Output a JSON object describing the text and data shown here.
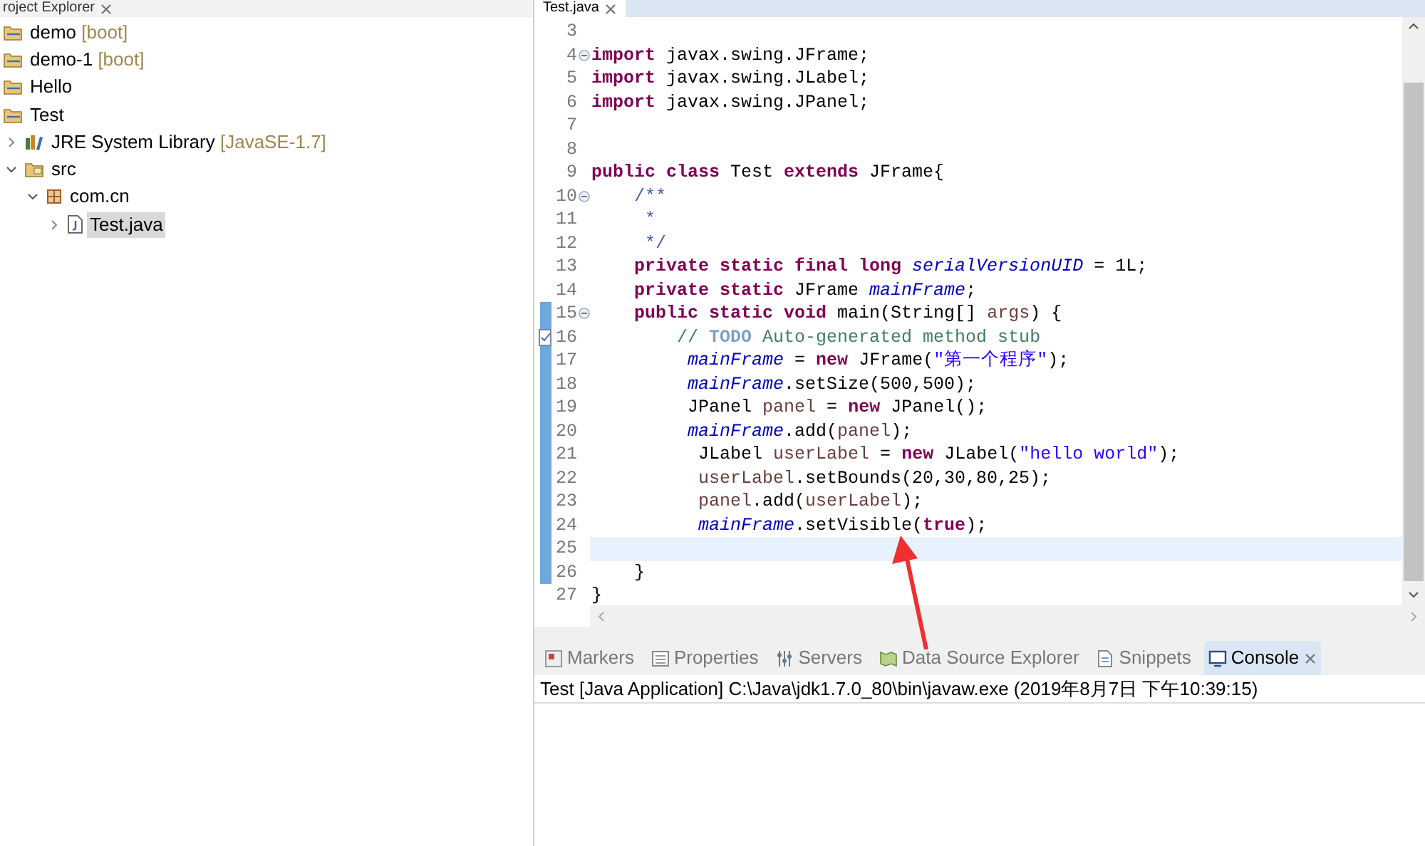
{
  "explorer": {
    "title": "roject Explorer",
    "tree": [
      {
        "kind": "project",
        "label": "demo",
        "decoration": "[boot]",
        "selected": false
      },
      {
        "kind": "project",
        "label": "demo-1",
        "decoration": "[boot]",
        "selected": false
      },
      {
        "kind": "project",
        "label": "Hello",
        "selected": false
      },
      {
        "kind": "project",
        "label": "Test",
        "selected": false,
        "children": [
          {
            "kind": "library",
            "label": "JRE System Library",
            "decoration": "[JavaSE-1.7]",
            "expanded": false,
            "selected": false
          },
          {
            "kind": "source-folder",
            "label": "src",
            "expanded": true,
            "selected": false,
            "children": [
              {
                "kind": "package",
                "label": "com.cn",
                "expanded": true,
                "selected": false,
                "children": [
                  {
                    "kind": "java-file",
                    "label": "Test.java",
                    "expanded": false,
                    "selected": true
                  }
                ]
              }
            ]
          }
        ]
      }
    ]
  },
  "editor": {
    "tab": "Test.java",
    "lines": [
      {
        "number": "3",
        "fold": false,
        "changed": false,
        "task": false,
        "current": false
      },
      {
        "number": "4",
        "fold": true,
        "changed": false,
        "task": false,
        "current": false,
        "tokens": [
          {
            "kind": "keyword",
            "text": "import"
          },
          {
            "kind": "plain",
            "text": " javax.swing.JFrame;"
          }
        ]
      },
      {
        "number": "5",
        "fold": false,
        "changed": false,
        "task": false,
        "current": false,
        "tokens": [
          {
            "kind": "keyword",
            "text": "import"
          },
          {
            "kind": "plain",
            "text": " javax.swing.JLabel;"
          }
        ]
      },
      {
        "number": "6",
        "fold": false,
        "changed": false,
        "task": false,
        "current": false,
        "tokens": [
          {
            "kind": "keyword",
            "text": "import"
          },
          {
            "kind": "plain",
            "text": " javax.swing.JPanel;"
          }
        ]
      },
      {
        "number": "7",
        "fold": false,
        "changed": false,
        "task": false,
        "current": false
      },
      {
        "number": "8",
        "fold": false,
        "changed": false,
        "task": false,
        "current": false
      },
      {
        "number": "9",
        "fold": false,
        "changed": false,
        "task": false,
        "current": false,
        "tokens": [
          {
            "kind": "keyword",
            "text": "public class"
          },
          {
            "kind": "plain",
            "text": " Test "
          },
          {
            "kind": "keyword",
            "text": "extends"
          },
          {
            "kind": "plain",
            "text": " JFrame{"
          }
        ]
      },
      {
        "number": "10",
        "fold": true,
        "changed": false,
        "task": false,
        "current": false,
        "tokens": [
          {
            "kind": "javadoc",
            "text": "    /**"
          }
        ]
      },
      {
        "number": "11",
        "fold": false,
        "changed": false,
        "task": false,
        "current": false,
        "tokens": [
          {
            "kind": "javadoc",
            "text": "     *"
          }
        ]
      },
      {
        "number": "12",
        "fold": false,
        "changed": false,
        "task": false,
        "current": false,
        "tokens": [
          {
            "kind": "javadoc",
            "text": "     */"
          }
        ]
      },
      {
        "number": "13",
        "fold": false,
        "changed": false,
        "task": false,
        "current": false,
        "tokens": [
          {
            "kind": "keyword",
            "text": "    private static final long"
          },
          {
            "kind": "field",
            "text": " serialVersionUID"
          },
          {
            "kind": "plain",
            "text": " = 1L;"
          }
        ]
      },
      {
        "number": "14",
        "fold": false,
        "changed": false,
        "task": false,
        "current": false,
        "tokens": [
          {
            "kind": "keyword",
            "text": "    private static"
          },
          {
            "kind": "plain",
            "text": " JFrame "
          },
          {
            "kind": "field",
            "text": "mainFrame"
          },
          {
            "kind": "plain",
            "text": ";"
          }
        ]
      },
      {
        "number": "15",
        "fold": true,
        "changed": true,
        "task": false,
        "current": false,
        "tokens": [
          {
            "kind": "keyword",
            "text": "    public static void"
          },
          {
            "kind": "plain",
            "text": " main(String[] "
          },
          {
            "kind": "local",
            "text": "args"
          },
          {
            "kind": "plain",
            "text": ") {"
          }
        ]
      },
      {
        "number": "16",
        "fold": false,
        "changed": true,
        "task": true,
        "current": false,
        "tokens": [
          {
            "kind": "comment",
            "text": "        // "
          },
          {
            "kind": "todo",
            "text": "TODO"
          },
          {
            "kind": "comment",
            "text": " Auto-generated method stub"
          }
        ]
      },
      {
        "number": "17",
        "fold": false,
        "changed": true,
        "task": false,
        "current": false,
        "tokens": [
          {
            "kind": "field",
            "text": "         mainFrame"
          },
          {
            "kind": "plain",
            "text": " = "
          },
          {
            "kind": "keyword",
            "text": "new"
          },
          {
            "kind": "plain",
            "text": " JFrame("
          },
          {
            "kind": "string",
            "text": "\"第一个程序\""
          },
          {
            "kind": "plain",
            "text": ");"
          }
        ]
      },
      {
        "number": "18",
        "fold": false,
        "changed": true,
        "task": false,
        "current": false,
        "tokens": [
          {
            "kind": "field",
            "text": "         mainFrame"
          },
          {
            "kind": "plain",
            "text": ".setSize(500,500);"
          }
        ]
      },
      {
        "number": "19",
        "fold": false,
        "changed": true,
        "task": false,
        "current": false,
        "tokens": [
          {
            "kind": "plain",
            "text": "         JPanel "
          },
          {
            "kind": "local",
            "text": "panel"
          },
          {
            "kind": "plain",
            "text": " = "
          },
          {
            "kind": "keyword",
            "text": "new"
          },
          {
            "kind": "plain",
            "text": " JPanel();"
          }
        ]
      },
      {
        "number": "20",
        "fold": false,
        "changed": true,
        "task": false,
        "current": false,
        "tokens": [
          {
            "kind": "field",
            "text": "         mainFrame"
          },
          {
            "kind": "plain",
            "text": ".add("
          },
          {
            "kind": "local",
            "text": "panel"
          },
          {
            "kind": "plain",
            "text": ");"
          }
        ]
      },
      {
        "number": "21",
        "fold": false,
        "changed": true,
        "task": false,
        "current": false,
        "tokens": [
          {
            "kind": "plain",
            "text": "          JLabel "
          },
          {
            "kind": "local",
            "text": "userLabel"
          },
          {
            "kind": "plain",
            "text": " = "
          },
          {
            "kind": "keyword",
            "text": "new"
          },
          {
            "kind": "plain",
            "text": " JLabel("
          },
          {
            "kind": "string",
            "text": "\"hello world\""
          },
          {
            "kind": "plain",
            "text": ");"
          }
        ]
      },
      {
        "number": "22",
        "fold": false,
        "changed": true,
        "task": false,
        "current": false,
        "tokens": [
          {
            "kind": "local",
            "text": "          userLabel"
          },
          {
            "kind": "plain",
            "text": ".setBounds(20,30,80,25);"
          }
        ]
      },
      {
        "number": "23",
        "fold": false,
        "changed": true,
        "task": false,
        "current": false,
        "tokens": [
          {
            "kind": "local",
            "text": "          panel"
          },
          {
            "kind": "plain",
            "text": ".add("
          },
          {
            "kind": "local",
            "text": "userLabel"
          },
          {
            "kind": "plain",
            "text": ");"
          }
        ]
      },
      {
        "number": "24",
        "fold": false,
        "changed": true,
        "task": false,
        "current": false,
        "tokens": [
          {
            "kind": "field",
            "text": "          mainFrame"
          },
          {
            "kind": "plain",
            "text": ".setVisible("
          },
          {
            "kind": "keyword",
            "text": "true"
          },
          {
            "kind": "plain",
            "text": ");"
          }
        ]
      },
      {
        "number": "25",
        "fold": false,
        "changed": true,
        "task": false,
        "current": true
      },
      {
        "number": "26",
        "fold": false,
        "changed": true,
        "task": false,
        "current": false,
        "tokens": [
          {
            "kind": "plain",
            "text": "    }"
          }
        ]
      },
      {
        "number": "27",
        "fold": false,
        "changed": false,
        "task": false,
        "current": false,
        "tokens": [
          {
            "kind": "plain",
            "text": "}"
          }
        ]
      }
    ]
  },
  "bottom_panel": {
    "tabs": [
      {
        "kind": "markers",
        "label": "Markers",
        "selected": false
      },
      {
        "kind": "properties",
        "label": "Properties",
        "selected": false
      },
      {
        "kind": "servers",
        "label": "Servers",
        "selected": false
      },
      {
        "kind": "data-source",
        "label": "Data Source Explorer",
        "selected": false
      },
      {
        "kind": "snippets",
        "label": "Snippets",
        "selected": false
      },
      {
        "kind": "console",
        "label": "Console",
        "selected": true
      }
    ],
    "console_header": "Test [Java Application] C:\\Java\\jdk1.7.0_80\\bin\\javaw.exe (2019年8月7日 下午10:39:15)"
  }
}
